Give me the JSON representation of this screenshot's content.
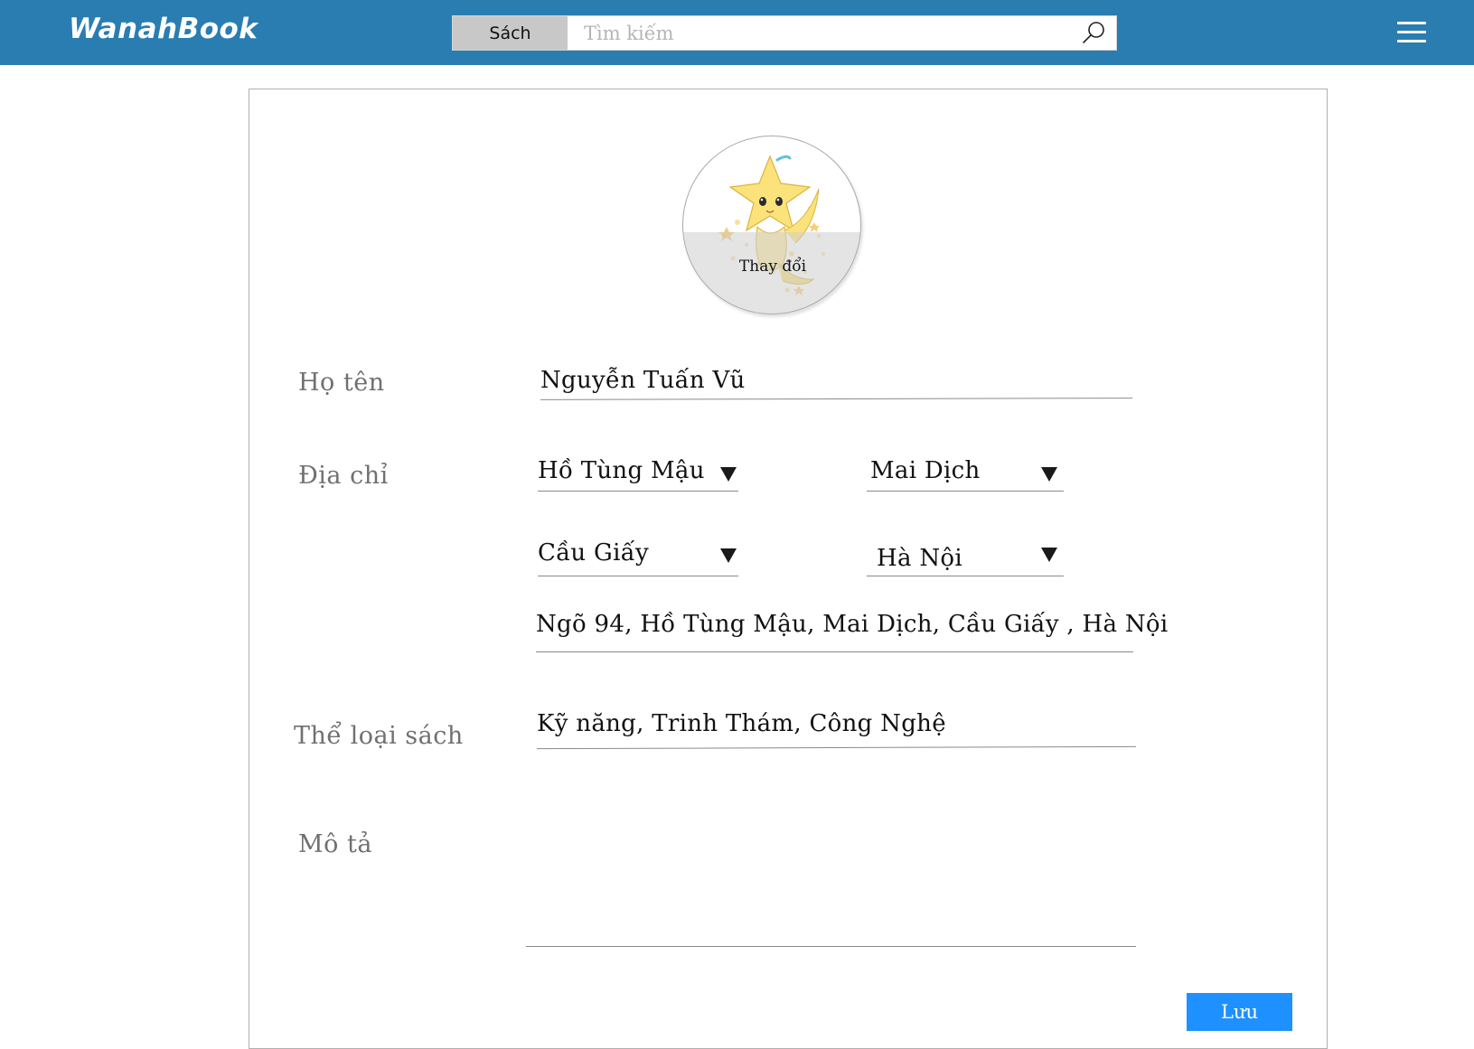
{
  "header": {
    "logo": "WanahBook",
    "search_category": "Sách",
    "search_placeholder": "Tìm kiếm",
    "icons": {
      "search": "search-icon",
      "menu": "hamburger-menu-icon"
    },
    "bar_color": "#2a7db1"
  },
  "profile": {
    "avatar_change_label": "Thay đổi",
    "fields": {
      "name": {
        "label": "Họ tên",
        "value": "Nguyễn Tuấn Vũ"
      },
      "address": {
        "label": "Địa chỉ",
        "street": "Hồ Tùng Mậu",
        "ward": "Mai Dịch",
        "district": "Cầu Giấy",
        "city": "Hà Nội",
        "full": "Ngõ 94, Hồ Tùng Mậu, Mai Dịch, Cầu Giấy , Hà Nội"
      },
      "genres": {
        "label": "Thể loại sách",
        "value": "Kỹ năng, Trinh Thám, Công Nghệ"
      },
      "description": {
        "label": "Mô tả",
        "value": ""
      }
    },
    "save_label": "Lưu",
    "save_color": "#1e90ff"
  }
}
